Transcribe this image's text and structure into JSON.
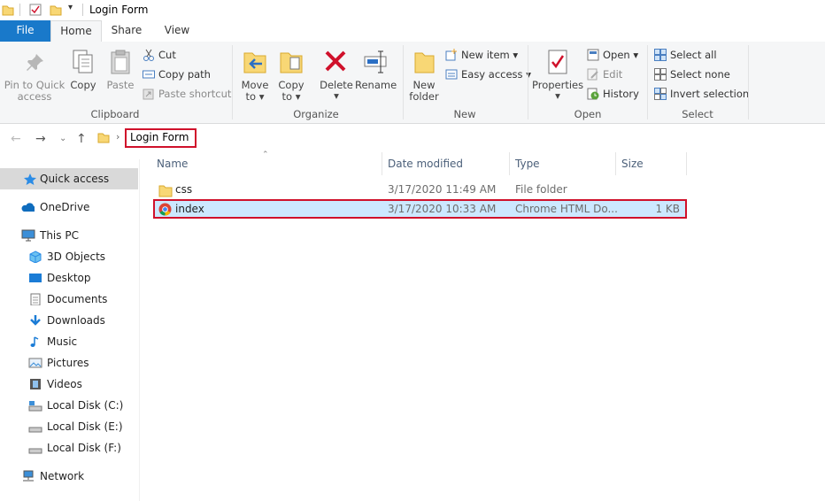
{
  "window": {
    "title": "Login Form"
  },
  "tabs": [
    {
      "label": "File"
    },
    {
      "label": "Home"
    },
    {
      "label": "Share"
    },
    {
      "label": "View"
    }
  ],
  "ribbon": {
    "clipboard": {
      "pin": "Pin to Quick access",
      "pin_line1": "Pin to Quick",
      "pin_line2": "access",
      "copy": "Copy",
      "paste": "Paste",
      "cut": "Cut",
      "copy_path": "Copy path",
      "paste_shortcut": "Paste shortcut",
      "label": "Clipboard"
    },
    "organize": {
      "move_to_line1": "Move",
      "move_to_line2": "to",
      "copy_to_line1": "Copy",
      "copy_to_line2": "to",
      "delete": "Delete",
      "rename": "Rename",
      "label": "Organize"
    },
    "new": {
      "new_folder_line1": "New",
      "new_folder_line2": "folder",
      "new_item": "New item",
      "easy_access": "Easy access",
      "label": "New"
    },
    "open": {
      "properties": "Properties",
      "open": "Open",
      "edit": "Edit",
      "history": "History",
      "label": "Open"
    },
    "select": {
      "select_all": "Select all",
      "select_none": "Select none",
      "invert_selection": "Invert selection",
      "label": "Select"
    }
  },
  "address": {
    "path": "Login Form"
  },
  "nav": {
    "items": [
      {
        "label": "Quick access",
        "icon": "star-icon"
      },
      {
        "label": "OneDrive",
        "icon": "cloud-icon"
      },
      {
        "label": "This PC",
        "icon": "computer-icon"
      },
      {
        "label": "3D Objects",
        "icon": "cube-icon"
      },
      {
        "label": "Desktop",
        "icon": "desktop-icon"
      },
      {
        "label": "Documents",
        "icon": "documents-icon"
      },
      {
        "label": "Downloads",
        "icon": "downloads-icon"
      },
      {
        "label": "Music",
        "icon": "music-icon"
      },
      {
        "label": "Pictures",
        "icon": "pictures-icon"
      },
      {
        "label": "Videos",
        "icon": "videos-icon"
      },
      {
        "label": "Local Disk (C:)",
        "icon": "drive-icon"
      },
      {
        "label": "Local Disk (E:)",
        "icon": "drive-icon"
      },
      {
        "label": "Local Disk (F:)",
        "icon": "drive-icon"
      },
      {
        "label": "Network",
        "icon": "network-icon"
      }
    ]
  },
  "files": {
    "columns": {
      "name": "Name",
      "date": "Date modified",
      "type": "Type",
      "size": "Size"
    },
    "rows": [
      {
        "name": "css",
        "date": "3/17/2020 11:49 AM",
        "type": "File folder",
        "size": "",
        "icon": "folder-icon"
      },
      {
        "name": "index",
        "date": "3/17/2020 10:33 AM",
        "type": "Chrome HTML Do...",
        "size": "1 KB",
        "icon": "chrome-icon"
      }
    ]
  },
  "colors": {
    "accent": "#1979ca",
    "highlight": "#d0112b",
    "selection": "#cce8ff"
  }
}
